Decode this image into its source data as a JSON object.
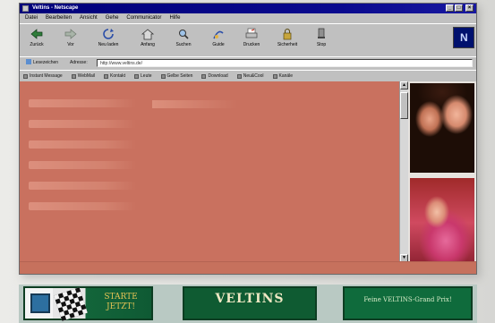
{
  "window": {
    "title": "Veltins - Netscape",
    "minimize": "_",
    "maximize": "□",
    "close": "×"
  },
  "menu": [
    "Datei",
    "Bearbeiten",
    "Ansicht",
    "Gehe",
    "Communicator",
    "Hilfe"
  ],
  "toolbar": {
    "buttons": [
      "Zurück",
      "Vor",
      "Neu laden",
      "Anfang",
      "Suchen",
      "Guide",
      "Drucken",
      "Sicherheit",
      "Stop"
    ]
  },
  "location": {
    "bookmarks_label": "Lesezeichen",
    "address_label": "Adresse:",
    "url": "http://www.veltins.de/"
  },
  "personal_bar": {
    "items": [
      "Instant Message",
      "WebMail",
      "Kontakt",
      "Leute",
      "Gelbe Seiten",
      "Download",
      "Neu&Cool",
      "Kanäle"
    ]
  },
  "page": {
    "nav": [
      "",
      "",
      "",
      "",
      "",
      ""
    ],
    "section_heading": "",
    "news": [
      {
        "line1": "",
        "line2": "",
        "line3": "",
        "date": ""
      },
      {
        "line1": "",
        "line2": "",
        "line3": "",
        "date": ""
      },
      {
        "line1": "",
        "line2": "",
        "line3": "",
        "date": ""
      },
      {
        "line1": "",
        "line2": "",
        "line3": "",
        "date": ""
      }
    ],
    "logo_text": "",
    "footer_links": "",
    "scroll_up": "▲",
    "scroll_down": "▼"
  },
  "banners": {
    "banner1_cta": "STARTE JETZT!",
    "banner2_brand": "VELTINS",
    "banner2_sub": "",
    "banner3_promo": "Feine VELTINS-Grand Prix!"
  }
}
